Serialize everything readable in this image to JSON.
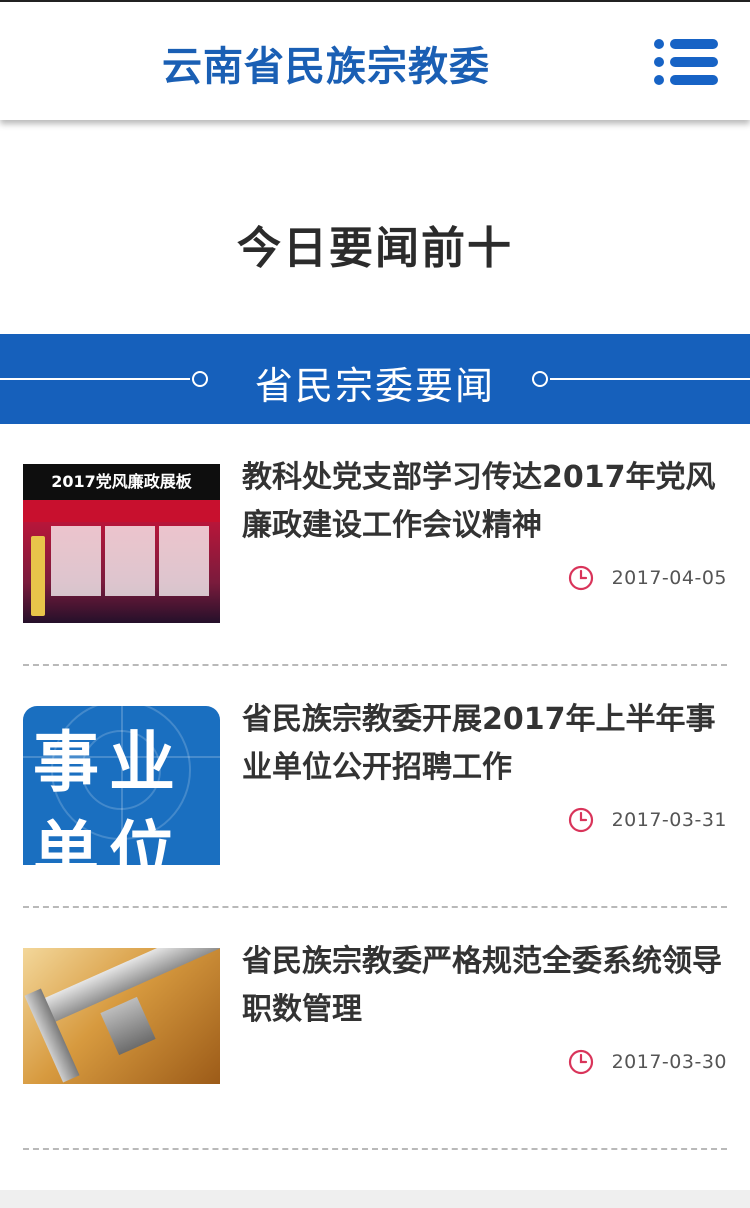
{
  "header": {
    "title": "云南省民族宗教委",
    "menu_icon": "menu-icon"
  },
  "page": {
    "heading": "今日要闻前十"
  },
  "section": {
    "title": "省民宗委要闻"
  },
  "news": [
    {
      "title": "教科处党支部学习传达2017年党风廉政建设工作会议精神",
      "date": "2017-04-05",
      "thumb_caption": "2017党风廉政展板"
    },
    {
      "title": "省民族宗教委开展2017年上半年事业单位公开招聘工作",
      "date": "2017-03-31",
      "thumb_row1": "事业",
      "thumb_row2": "单位"
    },
    {
      "title": "省民族宗教委严格规范全委系统领导职数管理",
      "date": "2017-03-30"
    }
  ],
  "colors": {
    "brand_blue": "#1a5fb4",
    "band_blue": "#1660bb",
    "clock_red": "#d9345a"
  }
}
